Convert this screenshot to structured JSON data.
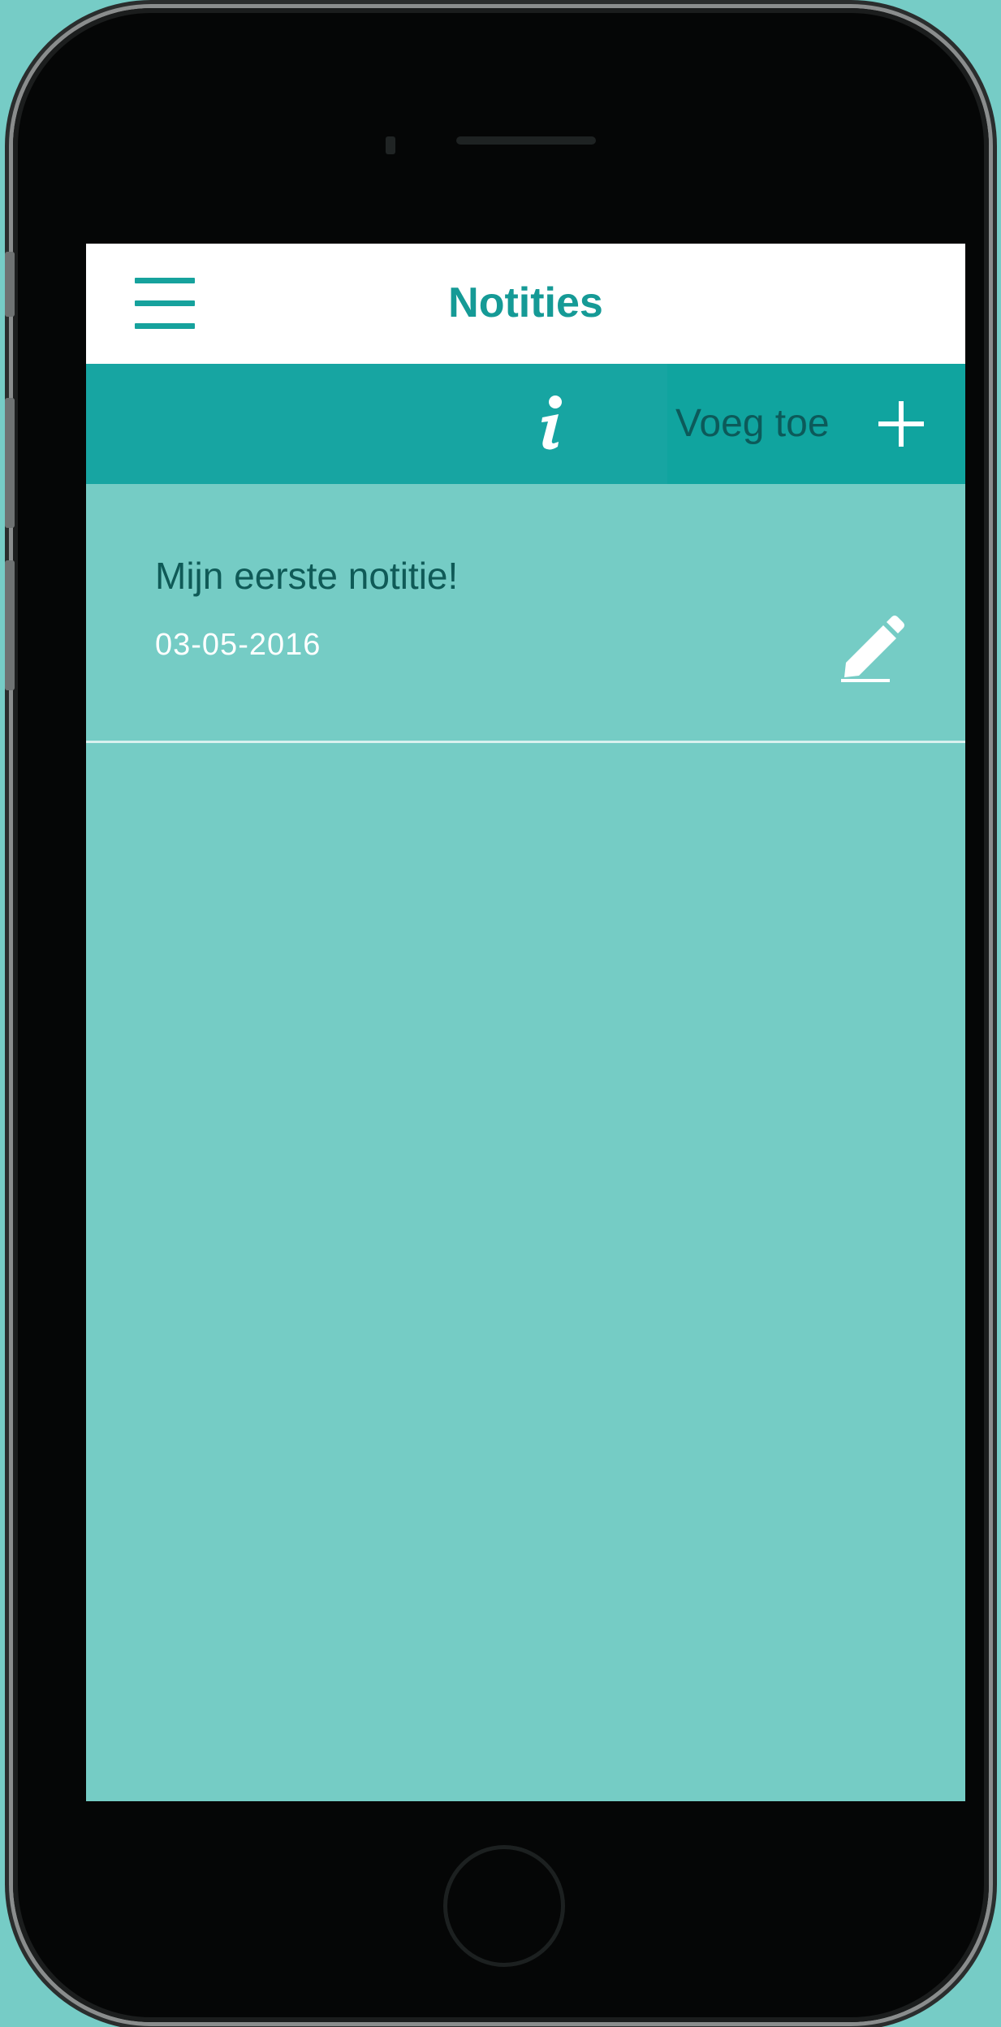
{
  "header": {
    "title": "Notities"
  },
  "toolbar": {
    "info_icon": "info-icon",
    "add_label": "Voeg toe",
    "add_icon": "plus-icon"
  },
  "notes": [
    {
      "title": "Mijn eerste notitie!",
      "date": "03-05-2016",
      "edit_icon": "pencil-icon"
    }
  ],
  "colors": {
    "background": "#76ccc6",
    "header_bg": "#ffffff",
    "title": "#159a96",
    "toolbar_bg": "#17a5a2",
    "add_button_bg": "#10a49f",
    "list_bg": "#75ccc5",
    "note_title": "#0f5a57",
    "note_date": "#ffffff"
  }
}
